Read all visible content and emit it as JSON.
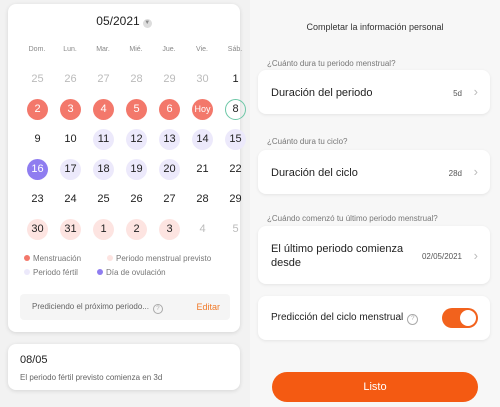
{
  "calendar": {
    "month": "05/2021",
    "weekdays": [
      "Dom.",
      "Lun.",
      "Mar.",
      "Mié.",
      "Jue.",
      "Vie.",
      "Sáb."
    ],
    "weeks": [
      [
        {
          "d": "25",
          "t": "muted"
        },
        {
          "d": "26",
          "t": "muted"
        },
        {
          "d": "27",
          "t": "muted"
        },
        {
          "d": "28",
          "t": "muted"
        },
        {
          "d": "29",
          "t": "muted"
        },
        {
          "d": "30",
          "t": "muted"
        },
        {
          "d": "1",
          "t": "normal"
        }
      ],
      [
        {
          "d": "2",
          "t": "period"
        },
        {
          "d": "3",
          "t": "period"
        },
        {
          "d": "4",
          "t": "period"
        },
        {
          "d": "5",
          "t": "period"
        },
        {
          "d": "6",
          "t": "period"
        },
        {
          "d": "Hoy",
          "t": "hoy"
        },
        {
          "d": "8",
          "t": "today"
        }
      ],
      [
        {
          "d": "9",
          "t": "normal"
        },
        {
          "d": "10",
          "t": "normal"
        },
        {
          "d": "11",
          "t": "fertile"
        },
        {
          "d": "12",
          "t": "fertile"
        },
        {
          "d": "13",
          "t": "fertile"
        },
        {
          "d": "14",
          "t": "fertile"
        },
        {
          "d": "15",
          "t": "fertile"
        }
      ],
      [
        {
          "d": "16",
          "t": "ovu"
        },
        {
          "d": "17",
          "t": "fertile"
        },
        {
          "d": "18",
          "t": "fertile"
        },
        {
          "d": "19",
          "t": "fertile"
        },
        {
          "d": "20",
          "t": "fertile"
        },
        {
          "d": "21",
          "t": "normal"
        },
        {
          "d": "22",
          "t": "normal"
        }
      ],
      [
        {
          "d": "23",
          "t": "normal"
        },
        {
          "d": "24",
          "t": "normal"
        },
        {
          "d": "25",
          "t": "normal"
        },
        {
          "d": "26",
          "t": "normal"
        },
        {
          "d": "27",
          "t": "normal"
        },
        {
          "d": "28",
          "t": "normal"
        },
        {
          "d": "29",
          "t": "normal"
        }
      ],
      [
        {
          "d": "30",
          "t": "pred"
        },
        {
          "d": "31",
          "t": "pred"
        },
        {
          "d": "1",
          "t": "pred"
        },
        {
          "d": "2",
          "t": "pred"
        },
        {
          "d": "3",
          "t": "pred"
        },
        {
          "d": "4",
          "t": "muted"
        },
        {
          "d": "5",
          "t": "muted"
        }
      ]
    ],
    "legend": {
      "menstruation": "Menstruación",
      "predicted": "Periodo menstrual previsto",
      "fertile": "Periodo fértil",
      "ovulation": "Día de ovulación"
    },
    "colors": {
      "period": "#f3786b",
      "fertile": "#ece9fb",
      "ovulation": "#8f7df0",
      "predicted": "#fde4e1",
      "accent": "#f45a12"
    },
    "prediction_text": "Prediciendo el próximo periodo...",
    "edit_label": "Editar"
  },
  "info_card": {
    "date": "08/05",
    "text": "El periodo fértil previsto comienza en 3d"
  },
  "settings": {
    "title": "Completar la información personal",
    "q1": "¿Cuánto dura tu periodo menstrual?",
    "period_label": "Duración del periodo",
    "period_value": "5d",
    "q2": "¿Cuánto dura tu ciclo?",
    "cycle_label": "Duración del ciclo",
    "cycle_value": "28d",
    "q3": "¿Cuándo comenzó tu último periodo menstrual?",
    "last_label": "El último periodo comienza desde",
    "last_value": "02/05/2021",
    "prediction_label": "Predicción del ciclo menstrual",
    "prediction_on": true,
    "done_label": "Listo"
  }
}
